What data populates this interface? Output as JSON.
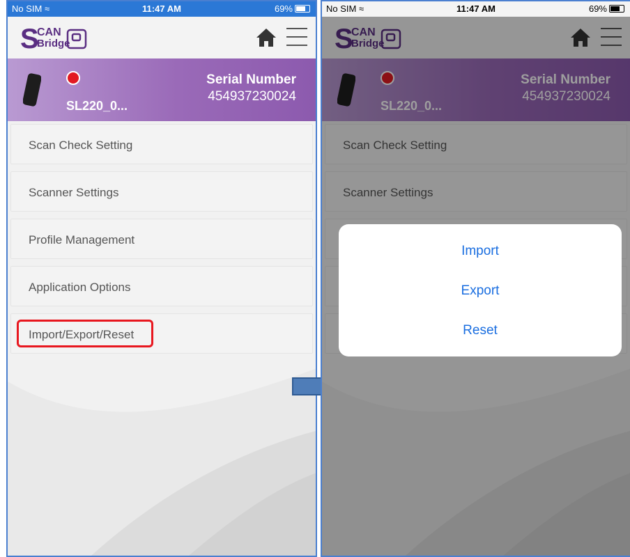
{
  "left_screen": {
    "status": {
      "carrier": "No SIM",
      "time": "11:47 AM",
      "battery": "69%"
    },
    "logo": {
      "s": "S",
      "can": "CAN",
      "bridge": "Bridge"
    },
    "device": {
      "name": "SL220_0...",
      "serial_label": "Serial Number",
      "serial_number": "454937230024"
    },
    "menu": [
      {
        "label": "Scan Check Setting"
      },
      {
        "label": "Scanner Settings"
      },
      {
        "label": "Profile Management"
      },
      {
        "label": "Application Options"
      },
      {
        "label": "Import/Export/Reset"
      }
    ],
    "highlighted_item": "Import/Export/Reset"
  },
  "right_screen": {
    "status": {
      "carrier": "No SIM",
      "time": "11:47 AM",
      "battery": "69%"
    },
    "logo": {
      "s": "S",
      "can": "CAN",
      "bridge": "Bridge"
    },
    "device": {
      "name": "SL220_0...",
      "serial_label": "Serial Number",
      "serial_number": "454937230024"
    },
    "menu": [
      {
        "label": "Scan Check Setting"
      },
      {
        "label": "Scanner Settings"
      }
    ],
    "dialog": {
      "options": [
        {
          "label": "Import"
        },
        {
          "label": "Export"
        },
        {
          "label": "Reset"
        }
      ]
    }
  },
  "colors": {
    "header_purple": "#9a6ab8",
    "status_blue": "#2b78d6",
    "accent_blue": "#1a6ee0",
    "highlight_red": "#e8171f",
    "status_dot_red": "#e21a22"
  },
  "icons": [
    "wifi-icon",
    "battery-icon",
    "home-icon",
    "hamburger-menu-icon",
    "scanner-device-icon",
    "arrow-right-icon"
  ]
}
